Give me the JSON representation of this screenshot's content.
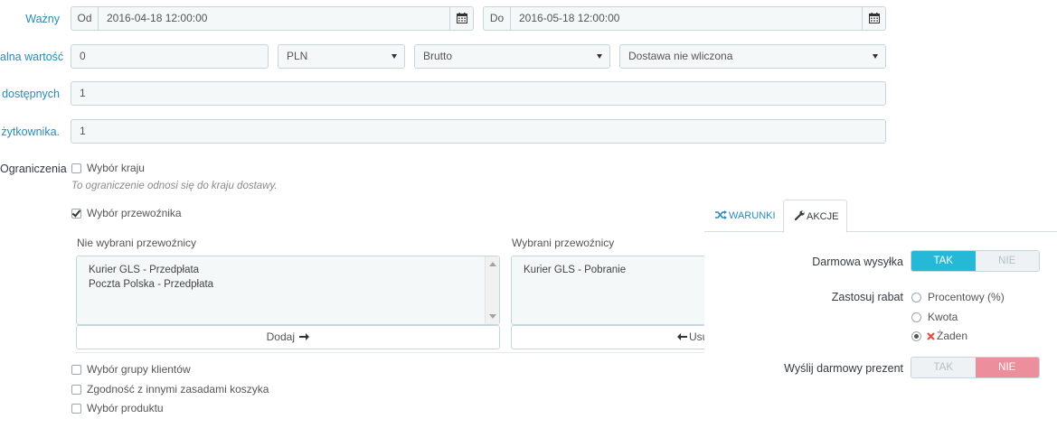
{
  "form": {
    "valid": {
      "label": "Ważny",
      "from_prefix": "Od",
      "from_value": "2016-04-18 12:00:00",
      "to_prefix": "Do",
      "to_value": "2016-05-18 12:00:00"
    },
    "min_amount": {
      "label": "alna wartość",
      "value": "0",
      "currency": "PLN",
      "tax": "Brutto",
      "shipping": "Dostawa nie wliczona"
    },
    "total_available": {
      "label": "dostępnych",
      "value": "1"
    },
    "per_user": {
      "label": "żytkownika.",
      "value": "1"
    },
    "restrictions": {
      "label": "Ograniczenia",
      "country": {
        "label": "Wybór kraju",
        "checked": false,
        "help": "To ograniczenie odnosi się do kraju dostawy."
      },
      "carrier": {
        "label": "Wybór przewoźnika",
        "checked": true,
        "unselected_title": "Nie wybrani przewoźnicy",
        "unselected_items": [
          "Kurier GLS - Przedpłata",
          "Poczta Polska - Przedpłata"
        ],
        "selected_title": "Wybrani przewoźnicy",
        "selected_items": [
          "Kurier GLS - Pobranie"
        ],
        "add_label": "Dodaj",
        "remove_label": "Usu"
      },
      "customer_group": {
        "label": "Wybór grupy klientów",
        "checked": false
      },
      "cart_rules": {
        "label": "Zgodność z innymi zasadami koszyka",
        "checked": false
      },
      "product": {
        "label": "Wybór produktu",
        "checked": false
      }
    }
  },
  "overlay": {
    "tabs": [
      {
        "label": "WARUNKI",
        "icon": "shuffle-icon",
        "active": false
      },
      {
        "label": "AKCJE",
        "icon": "wrench-icon",
        "active": true
      }
    ],
    "free_shipping": {
      "label": "Darmowa wysyłka",
      "yes": "TAK",
      "no": "NIE",
      "value": "TAK"
    },
    "discount": {
      "label": "Zastosuj rabat",
      "options": [
        "Procentowy (%)",
        "Kwota",
        "Żaden"
      ],
      "selected": "Żaden"
    },
    "free_gift": {
      "label": "Wyślij darmowy prezent",
      "yes": "TAK",
      "no": "NIE",
      "value": "NIE"
    }
  },
  "colors": {
    "label_blue": "#2a8ab8",
    "switch_on_blue": "#25b9d7",
    "switch_off_red": "#f54c3e",
    "switch_no_pink": "#ed8e9c",
    "red_x": "#e3503e"
  }
}
